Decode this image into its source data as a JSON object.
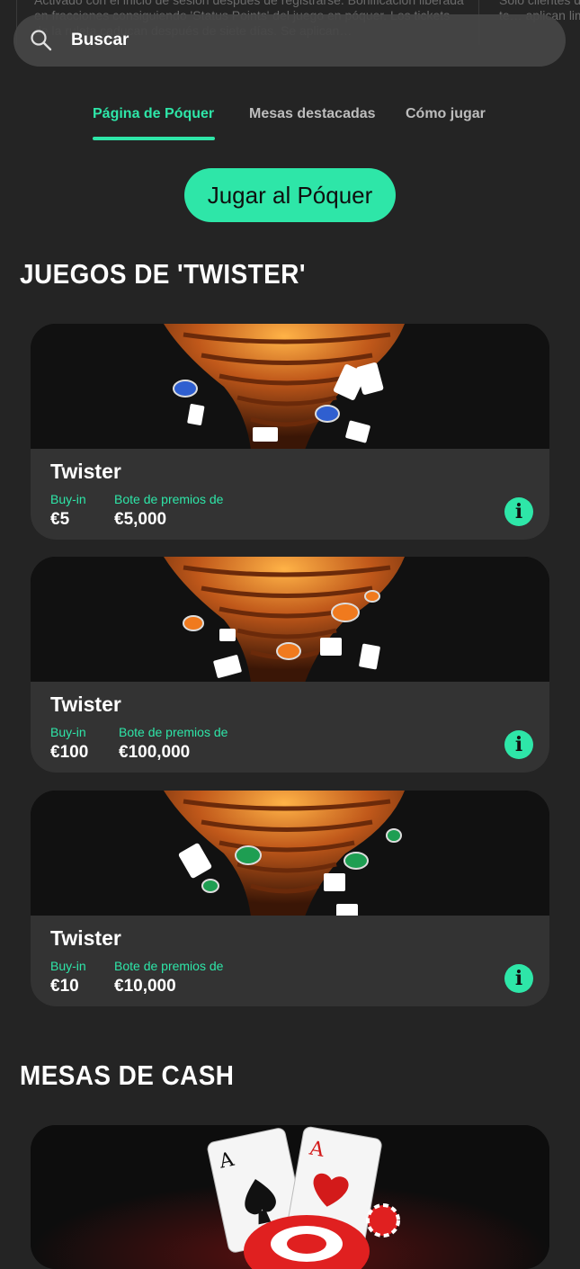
{
  "background_text": {
    "left": "Activado con el inicio de sesión después de registrarse. Bonificación liberada en fracciones consiguiendo 'Status Points' del juego en póquer. Los tickets de la ruleta caducan después de siete días. Se aplican…",
    "right": "Solo clientes de… Máximo de te… aplican limita…"
  },
  "search": {
    "label": "Buscar",
    "icon": "search-icon"
  },
  "tabs": [
    {
      "label": "Página de Póquer",
      "active": true
    },
    {
      "label": "Mesas destacadas",
      "active": false
    },
    {
      "label": "Cómo jugar",
      "active": false
    }
  ],
  "cta": {
    "label": "Jugar al Póquer"
  },
  "sections": {
    "twister": {
      "title": "JUEGOS DE 'TWISTER'"
    },
    "cash": {
      "title": "MESAS DE CASH"
    }
  },
  "cards": [
    {
      "name": "Twister",
      "buyin_label": "Buy-in",
      "buyin": "€5",
      "prize_label": "Bote de premios de",
      "prize": "€5,000",
      "chip_color": "#2f5fd0"
    },
    {
      "name": "Twister",
      "buyin_label": "Buy-in",
      "buyin": "€100",
      "prize_label": "Bote de premios de",
      "prize": "€100,000",
      "chip_color": "#f07a1e"
    },
    {
      "name": "Twister",
      "buyin_label": "Buy-in",
      "buyin": "€10",
      "prize_label": "Bote de premios de",
      "prize": "€10,000",
      "chip_color": "#1e9e52"
    }
  ],
  "info_icon": "i",
  "colors": {
    "accent": "#2ee6a8",
    "background": "#242424",
    "card_info": "#333333"
  }
}
